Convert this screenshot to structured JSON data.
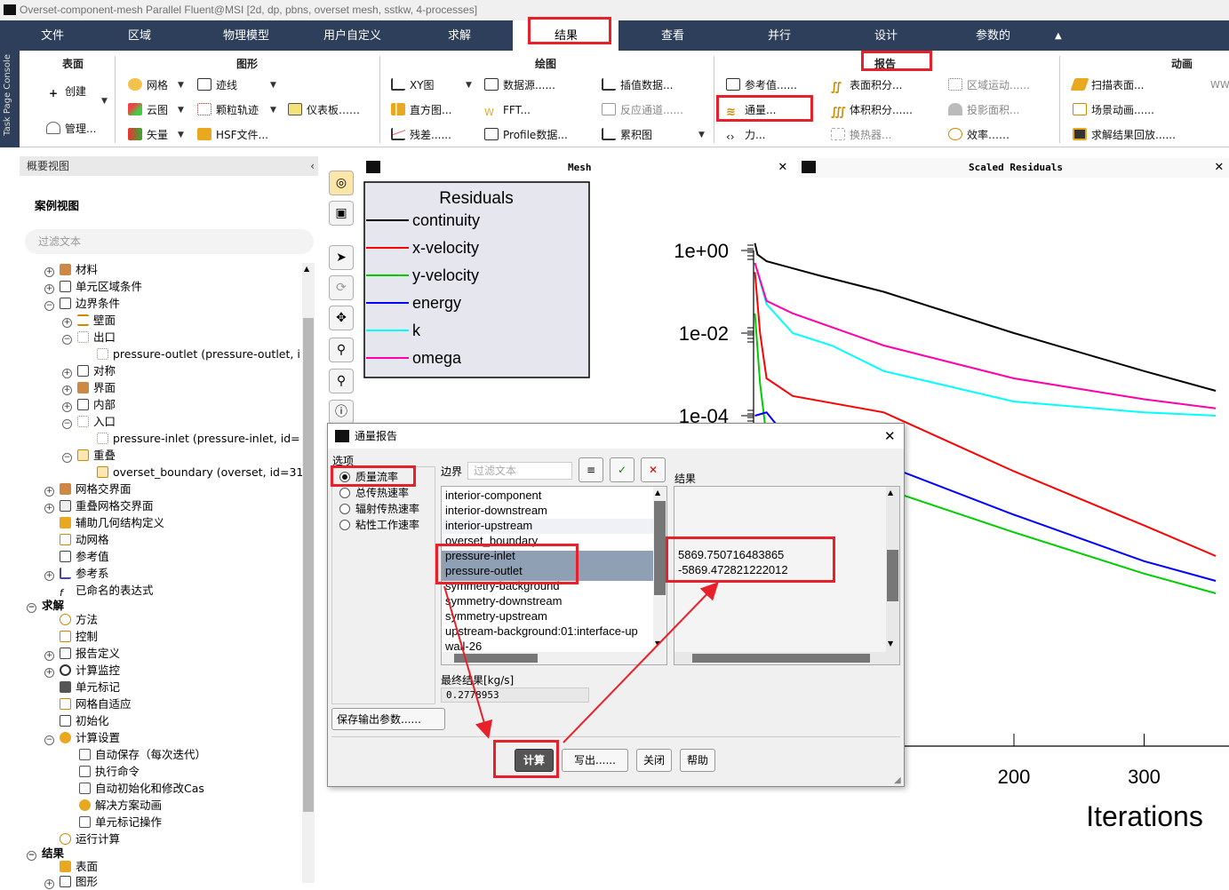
{
  "window": {
    "title": "Overset-component-mesh Parallel Fluent@MSI  [2d, dp, pbns, overset mesh, sstkw, 4-processes]"
  },
  "menu": [
    {
      "label": "文件"
    },
    {
      "label": "区域"
    },
    {
      "label": "物理模型"
    },
    {
      "label": "用户自定义"
    },
    {
      "label": "求解"
    },
    {
      "label": "结果"
    },
    {
      "label": "查看"
    },
    {
      "label": "并行"
    },
    {
      "label": "设计"
    },
    {
      "label": "参数的"
    }
  ],
  "task_page_tab": "Task Page Console",
  "ribbon": {
    "groups": {
      "surface": "表面",
      "graphics": "图形",
      "plots": "绘图",
      "reports": "报告",
      "animation": "动画"
    },
    "surface": {
      "create": "创建",
      "manage": "管理..."
    },
    "graphics": {
      "mesh": "网格",
      "contours": "云图",
      "vectors": "矢量",
      "pathlines": "迹线",
      "particle_tracks": "颗粒轨迹",
      "hsf": "HSF文件...",
      "dashboard": "仪表板……"
    },
    "plots": {
      "xy": "XY图",
      "histogram": "直方图...",
      "residuals": "残差......",
      "data_sources": "数据源......",
      "fft": "FFT...",
      "profile": "Profile数据...",
      "interp": "插值数据...",
      "reaction": "反应通道......",
      "cumulative": "累积图"
    },
    "reports": {
      "reference": "参考值......",
      "fluxes": "通量...",
      "forces": "力...",
      "surface_int": "表面积分...",
      "volume_int": "体积积分......",
      "heat_exch": "换热器...",
      "zone_motion": "区域运动......",
      "proj_area": "投影面积...",
      "efficiency": "效率……"
    },
    "animation": {
      "sweep": "扫描表面...",
      "scene": "场景动画......",
      "playback": "求解结果回放......"
    }
  },
  "outline": {
    "header": "概要视图",
    "case_view": "案例视图",
    "filter_placeholder": "过滤文本"
  },
  "tree": [
    {
      "label": "材料"
    },
    {
      "label": "单元区域条件"
    },
    {
      "label": "边界条件"
    },
    {
      "label": "壁面"
    },
    {
      "label": "出口"
    },
    {
      "label": "pressure-outlet (pressure-outlet, i"
    },
    {
      "label": "对称"
    },
    {
      "label": "界面"
    },
    {
      "label": "内部"
    },
    {
      "label": "入口"
    },
    {
      "label": "pressure-inlet (pressure-inlet, id="
    },
    {
      "label": "重叠"
    },
    {
      "label": "overset_boundary (overset, id=31"
    },
    {
      "label": "网格交界面"
    },
    {
      "label": "重叠网格交界面"
    },
    {
      "label": "辅助几何结构定义"
    },
    {
      "label": "动网格"
    },
    {
      "label": "参考值"
    },
    {
      "label": "参考系"
    },
    {
      "label": "已命名的表达式"
    },
    {
      "label": "求解"
    },
    {
      "label": "方法"
    },
    {
      "label": "控制"
    },
    {
      "label": "报告定义"
    },
    {
      "label": "计算监控"
    },
    {
      "label": "单元标记"
    },
    {
      "label": "网格自适应"
    },
    {
      "label": "初始化"
    },
    {
      "label": "计算设置"
    },
    {
      "label": "自动保存（每次迭代）"
    },
    {
      "label": "执行命令"
    },
    {
      "label": "自动初始化和修改Cas"
    },
    {
      "label": "解决方案动画"
    },
    {
      "label": "单元标记操作"
    },
    {
      "label": "运行计算"
    },
    {
      "label": "结果"
    },
    {
      "label": "表面"
    },
    {
      "label": "图形"
    }
  ],
  "windows": {
    "mesh_title": "Mesh",
    "residuals_title": "Scaled Residuals"
  },
  "chart_data": {
    "type": "line",
    "title": "",
    "xlabel": "Iterations",
    "ylabel": "",
    "yscale": "log",
    "x_ticks": [
      "200",
      "300"
    ],
    "y_ticks": [
      "1e+00",
      "1e-02",
      "1e-04"
    ],
    "legend_title": "Residuals",
    "series": [
      {
        "name": "continuity",
        "color": "#000000",
        "x": [
          1,
          3,
          10,
          50,
          100,
          200,
          300,
          355
        ],
        "y": [
          1.5,
          0.8,
          0.55,
          0.25,
          0.1,
          0.01,
          0.0012,
          0.0004
        ]
      },
      {
        "name": "x-velocity",
        "color": "#ff0000",
        "x": [
          1,
          5,
          10,
          30,
          100,
          200,
          300,
          355
        ],
        "y": [
          0.3,
          0.01,
          0.0008,
          0.0003,
          0.00012,
          4.5e-06,
          2.2e-07,
          4e-08
        ]
      },
      {
        "name": "y-velocity",
        "color": "#00cc00",
        "x": [
          1,
          5,
          10,
          30,
          100,
          200,
          300,
          355
        ],
        "y": [
          0.03,
          0.0006,
          3e-05,
          4.5e-06,
          1.7e-06,
          1.5e-07,
          1.5e-08,
          5e-09
        ]
      },
      {
        "name": "energy",
        "color": "#0000ff",
        "x": [
          1,
          10,
          30,
          100,
          200,
          300,
          355
        ],
        "y": [
          0.0001,
          0.00012,
          2e-05,
          6.5e-06,
          4e-07,
          3e-08,
          1e-08
        ]
      },
      {
        "name": "k",
        "color": "#00ffff",
        "x": [
          1,
          10,
          30,
          60,
          100,
          200,
          300,
          355
        ],
        "y": [
          0.5,
          0.05,
          0.01,
          0.005,
          0.0012,
          0.00022,
          0.00012,
          0.0001
        ]
      },
      {
        "name": "omega",
        "color": "#ff00aa",
        "x": [
          1,
          10,
          30,
          100,
          200,
          300,
          355
        ],
        "y": [
          0.5,
          0.06,
          0.03,
          0.005,
          0.0008,
          0.00025,
          0.00015
        ]
      }
    ]
  },
  "dialog": {
    "title": "通量报告",
    "options_label": "选项",
    "options": [
      {
        "label": "质量流率",
        "selected": true
      },
      {
        "label": "总传热速率",
        "selected": false
      },
      {
        "label": "辐射传热速率",
        "selected": false
      },
      {
        "label": "粘性工作速率",
        "selected": false
      }
    ],
    "boundaries_label": "边界",
    "filter_placeholder": "过滤文本",
    "boundaries": [
      {
        "label": "interior-component",
        "selected": false
      },
      {
        "label": "interior-downstream",
        "selected": false
      },
      {
        "label": "interior-upstream",
        "selected": false
      },
      {
        "label": "overset_boundary",
        "selected": false
      },
      {
        "label": "pressure-inlet",
        "selected": true
      },
      {
        "label": "pressure-outlet",
        "selected": true
      },
      {
        "label": "symmetry-background",
        "selected": false
      },
      {
        "label": "symmetry-downstream",
        "selected": false
      },
      {
        "label": "symmetry-upstream",
        "selected": false
      },
      {
        "label": "upstream-background:01:interface-up",
        "selected": false
      },
      {
        "label": "wall-26",
        "selected": false
      }
    ],
    "results_label": "结果",
    "results": [
      "5869.750716483865",
      "-5869.472821222012"
    ],
    "final_result_label": "最终结果[kg/s]",
    "final_result": "0.2778953",
    "save_params": "保存输出参数......",
    "buttons": {
      "compute": "计算",
      "write": "写出......",
      "close": "关闭",
      "help": "帮助"
    }
  },
  "colors": {
    "menubar": "#2d3f5a",
    "highlight": "#e8202a",
    "selection": "#8f9fb4"
  }
}
